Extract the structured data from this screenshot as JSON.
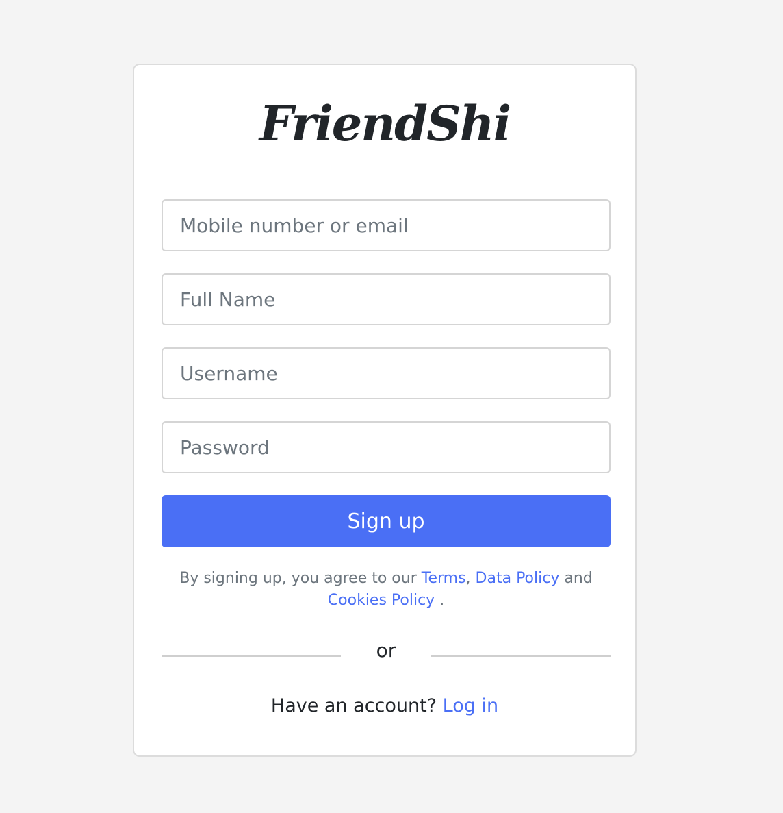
{
  "brand": {
    "logo_text": "FriendShi"
  },
  "form": {
    "contact_placeholder": "Mobile number or email",
    "fullname_placeholder": "Full Name",
    "username_placeholder": "Username",
    "password_placeholder": "Password",
    "submit_label": "Sign up"
  },
  "terms": {
    "prefix": "By signing up, you agree to our",
    "terms_link": "Terms",
    "comma": ",",
    "data_policy_link": "Data Policy",
    "and": "and",
    "cookies_link": "Cookies Policy",
    "period": "."
  },
  "divider": {
    "label": "or"
  },
  "login": {
    "prompt": "Have an account?",
    "link": "Log in"
  },
  "colors": {
    "accent": "#4a6ff5",
    "background": "#f4f4f4",
    "card": "#ffffff",
    "border": "#dcdcdc"
  }
}
